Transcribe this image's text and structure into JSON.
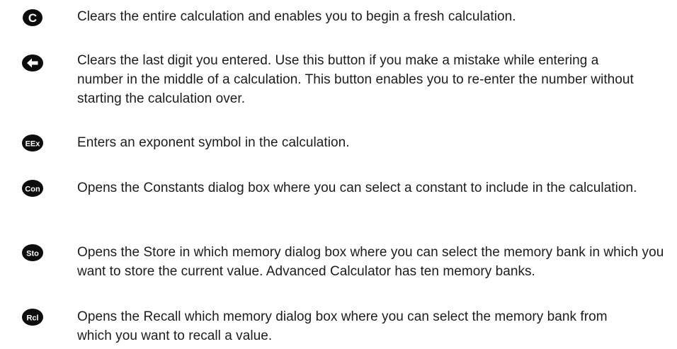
{
  "rows": [
    {
      "icon": "clear-all-icon",
      "icon_label": "C",
      "text": "Clears the entire calculation and enables you to begin a fresh calculation."
    },
    {
      "icon": "backspace-arrow-icon",
      "icon_label": "",
      "text": "Clears the last digit you entered. Use this button if you make a mistake while entering a number in the middle of a calculation. This button enables you to re-enter the number without starting the calculation over."
    },
    {
      "icon": "exponent-icon",
      "icon_label": "EEx",
      "text": "Enters an exponent symbol in the calculation."
    },
    {
      "icon": "constants-icon",
      "icon_label": "Con",
      "text": "Opens the Constants dialog box where you can select a constant to include in the calculation."
    },
    {
      "icon": "store-memory-icon",
      "icon_label": "Sto",
      "text": "Opens the Store in which memory dialog box where you can select the memory bank in which you want to store the current value. Advanced Calculator has ten memory banks."
    },
    {
      "icon": "recall-memory-icon",
      "icon_label": "Rcl",
      "text": "Opens the Recall which memory dialog box where you can select the memory bank from which you want to recall a value."
    }
  ]
}
